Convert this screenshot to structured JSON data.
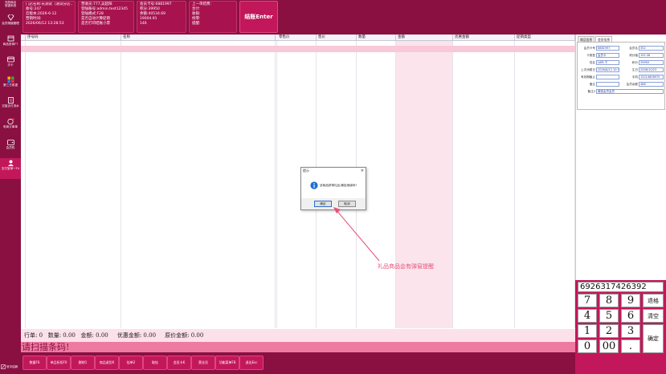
{
  "sidebar": {
    "top_label_1": "天丽商店",
    "top_label_2": "收银系统",
    "items": [
      {
        "icon": "diamond-icon",
        "label": "会员储值管理"
      },
      {
        "icon": "store-icon",
        "label": "商品查询F7"
      },
      {
        "icon": "card-icon",
        "label": "次卡"
      },
      {
        "icon": "grid-icon",
        "label": "第三方收银"
      },
      {
        "icon": "document-icon",
        "label": "交接支付流水"
      },
      {
        "icon": "clock-badge-icon",
        "label": "电商订单单"
      },
      {
        "icon": "wallet-icon",
        "label": "会员机"
      },
      {
        "icon": "person-icon",
        "label": "支付宝单一F4"
      }
    ],
    "bottom_label": "班中结款"
  },
  "info": {
    "store": "门店名称:长测试（测试分店...",
    "register": "收号:247",
    "expiry": "云版本:2026-6-12",
    "order_time": "营销时间:",
    "datetime": "2026/06/12 13:28:53",
    "cashier": "营收员:777,吴超阳",
    "account": "登陆账号:admin.test12345",
    "scheme": "登陆模式:F28",
    "auto_discount": "是否自动计算促销",
    "print_receipt": "是否打印结账小票",
    "member_card": "会员卡号:6881997",
    "points": "积分:39950",
    "balance": "余额:40534.69",
    "amount1": "19004.91",
    "amount2": "146",
    "last_title": "上一单结费:",
    "last_total": "合计:",
    "last_paid": "收银:",
    "last_change": "找零:",
    "last_note": "提醒:"
  },
  "enter_button": "结账Enter",
  "grid": {
    "headers": [
      "序号码",
      "名称",
      "",
      "零售价",
      "售价",
      "数量",
      "金额",
      "优惠金额",
      "促销类型"
    ]
  },
  "right_panel": {
    "tabs": [
      "商品信息",
      "会员信息"
    ],
    "fields": [
      {
        "label": "会员卡号",
        "value": "6881997"
      },
      {
        "label": "会员名",
        "value": "302"
      },
      {
        "label": "卡类型",
        "value": "会员卡"
      },
      {
        "label": "积分值",
        "value": "191.36"
      },
      {
        "label": "性名",
        "value": "LWR-下"
      },
      {
        "label": "积分",
        "value": "39950"
      },
      {
        "label": "上次消费日",
        "value": "2026/6/12 10:3"
      },
      {
        "label": "生日",
        "value": "2006/10/23"
      },
      {
        "label": "有效期截止",
        "value": ""
      },
      {
        "label": "手机",
        "value": "15214806970"
      },
      {
        "label": "备注",
        "value": ""
      },
      {
        "label": "会员余额",
        "value": "488"
      },
      {
        "label": "备注2",
        "value": "微信会员会员"
      }
    ]
  },
  "numpad": {
    "barcode": "6926317426392",
    "keys": [
      "7",
      "8",
      "9",
      "4",
      "5",
      "6",
      "1",
      "2",
      "3",
      "0",
      "00",
      "."
    ],
    "back_label": "退格",
    "clear_label": "清空",
    "confirm_label": "确定"
  },
  "summary": {
    "text": "行单: 0   数量: 0.00   金额: 0.00     优惠金额: 0.00     原价金额: 0.00"
  },
  "scan_prompt": "请扫描条码!",
  "bottom_buttons": [
    "数量F6",
    "单品折扣F0",
    "删除1",
    "商品退货K",
    "挂单2",
    "取挂",
    "会员卡K",
    "营业员",
    "功能菜单F8",
    "退出Esc"
  ],
  "dialog": {
    "title": "提示",
    "message": "该商品获得礼品,确定继续吗?",
    "ok": "确定",
    "cancel": "取消"
  },
  "annotation": "礼品商品会有弹窗提醒",
  "colors": {
    "sidebar": "#8a1042",
    "accent": "#c2185b",
    "selected_row": "#f9c8d9",
    "scan_bar": "#ee7aa2",
    "annotation": "#e8527a"
  }
}
